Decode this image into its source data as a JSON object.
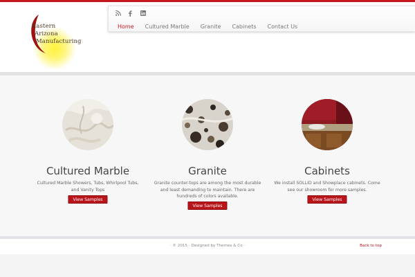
{
  "brand": {
    "logo_lines": [
      "Eastern",
      "Arizona",
      "Manufacturing"
    ],
    "accent_color": "#c4161c"
  },
  "social": [
    {
      "icon": "rss-icon"
    },
    {
      "icon": "facebook-icon"
    },
    {
      "icon": "linkedin-icon"
    }
  ],
  "nav": {
    "items": [
      {
        "label": "Home",
        "active": true
      },
      {
        "label": "Cultured Marble",
        "active": false
      },
      {
        "label": "Granite",
        "active": false
      },
      {
        "label": "Cabinets",
        "active": false
      },
      {
        "label": "Contact Us",
        "active": false
      }
    ]
  },
  "features": [
    {
      "title": "Cultured Marble",
      "description": "Cultured Marble Showers, Tubs, Whirlpool Tubs, and Vanity Tops",
      "button": "View Samples"
    },
    {
      "title": "Granite",
      "description": "Granite counter-tops are among the most durable and least demanding to maintain. There are hundreds of colors available.",
      "button": "View Samples"
    },
    {
      "title": "Cabinets",
      "description": "We install SOLLID and Showplace cabinets. Come see our showroom for more samples.",
      "button": "View Samples"
    }
  ],
  "footer": {
    "copyright": "· © 2015 · Designed by Themes & Co ·",
    "back_to_top": "Back to top"
  }
}
